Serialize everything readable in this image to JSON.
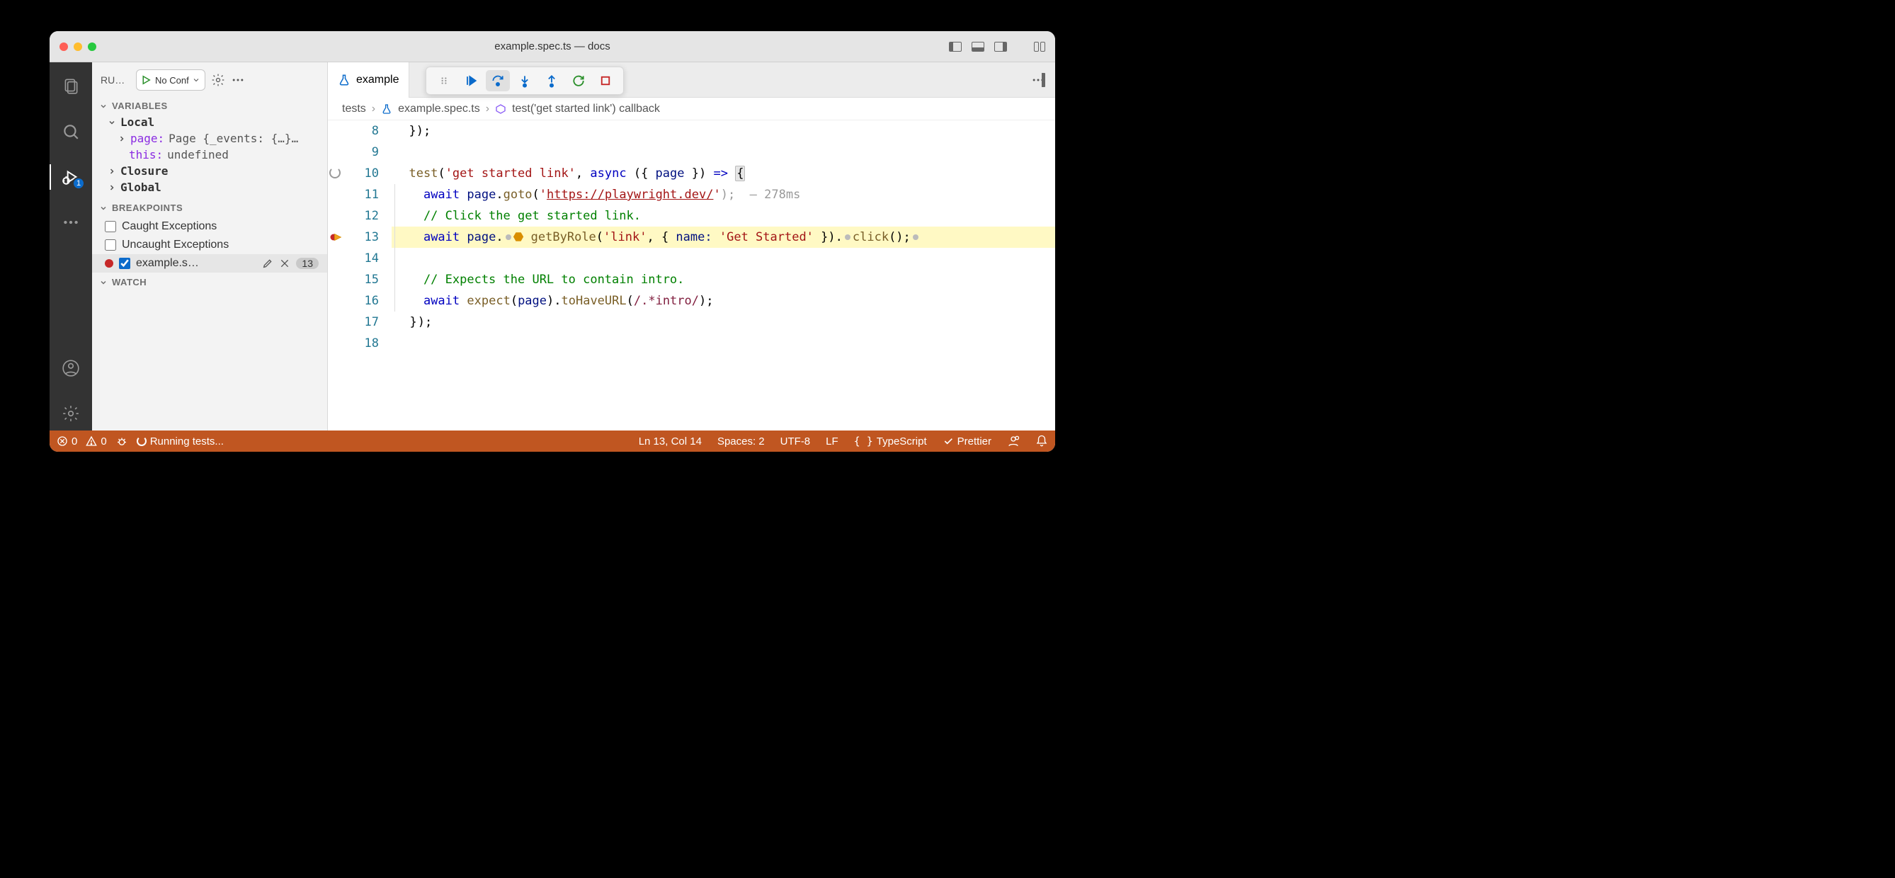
{
  "titlebar": {
    "title": "example.spec.ts — docs"
  },
  "activitybar": {
    "debug_badge": "1"
  },
  "sidebar": {
    "run_label": "RU…",
    "config": "No Conf",
    "sections": {
      "variables": "Variables",
      "breakpoints": "Breakpoints",
      "watch": "Watch"
    },
    "variables": {
      "local": "Local",
      "page_key": "page:",
      "page_val": "Page {_events: {…}…",
      "this_key": "this:",
      "this_val": "undefined",
      "closure": "Closure",
      "global": "Global"
    },
    "breakpoints": {
      "caught": "Caught Exceptions",
      "uncaught": "Uncaught Exceptions",
      "file": "example.s…",
      "line_badge": "13"
    }
  },
  "tab": {
    "label": "example"
  },
  "breadcrumb": {
    "p1": "tests",
    "p2": "example.spec.ts",
    "p3": "test('get started link') callback"
  },
  "code": {
    "l8": "  });",
    "l9": "",
    "l10_a": "  ",
    "l10_fn": "test",
    "l10_b": "(",
    "l10_s": "'get started link'",
    "l10_c": ", ",
    "l10_kw": "async",
    "l10_d": " ({ ",
    "l10_v": "page",
    "l10_e": " }) ",
    "l10_ar": "=>",
    "l10_f": " ",
    "l10_br": "{",
    "l11_a": "    ",
    "l11_kw": "await",
    "l11_b": " ",
    "l11_v": "page",
    "l11_c": ".",
    "l11_fn": "goto",
    "l11_d": "(",
    "l11_q": "'",
    "l11_url": "https://playwright.dev/",
    "l11_q2": "'",
    "l11_e": ");  — ",
    "l11_t": "278ms",
    "l12": "    // Click the get started link.",
    "l13_a": "    ",
    "l13_kw": "await",
    "l13_b": " ",
    "l13_v": "page",
    "l13_c": ".",
    "l13_fn": "getByRole",
    "l13_d": "(",
    "l13_s": "'link'",
    "l13_e": ", { ",
    "l13_k": "name:",
    "l13_f": " ",
    "l13_s2": "'Get Started'",
    "l13_g": " }).",
    "l13_fn2": "click",
    "l13_h": "();",
    "l14": "",
    "l15": "    // Expects the URL to contain intro.",
    "l16_a": "    ",
    "l16_kw": "await",
    "l16_b": " ",
    "l16_fn": "expect",
    "l16_c": "(",
    "l16_v": "page",
    "l16_d": ").",
    "l16_fn2": "toHaveURL",
    "l16_e": "(",
    "l16_rx": "/.*intro/",
    "l16_f": ");",
    "l17": "  });",
    "l18": ""
  },
  "line_numbers": [
    "8",
    "9",
    "10",
    "11",
    "12",
    "13",
    "14",
    "15",
    "16",
    "17",
    "18"
  ],
  "statusbar": {
    "errors": "0",
    "warnings": "0",
    "running": "Running tests...",
    "cursor": "Ln 13, Col 14",
    "spaces": "Spaces: 2",
    "encoding": "UTF-8",
    "eol": "LF",
    "lang": "TypeScript",
    "prettier": "Prettier"
  }
}
